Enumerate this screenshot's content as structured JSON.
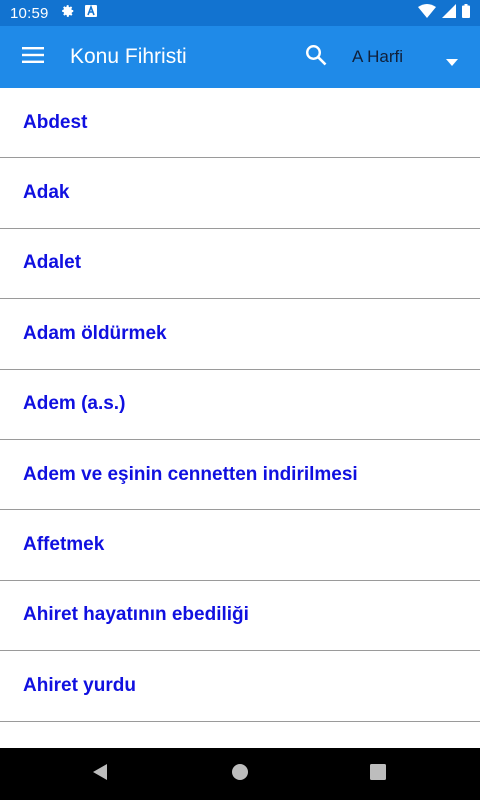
{
  "status_bar": {
    "time": "10:59",
    "icons": [
      "settings-icon",
      "keyboard-a-icon",
      "wifi-icon",
      "signal-icon",
      "battery-icon"
    ]
  },
  "app_bar": {
    "title": "Konu Fihristi",
    "menu_icon": "hamburger-menu-icon",
    "search_icon": "search-icon",
    "letter_select": {
      "value": "A Harfi",
      "icon": "dropdown-arrow-icon"
    }
  },
  "topics": [
    "Abdest",
    "Adak",
    "Adalet",
    "Adam öldürmek",
    "Adem (a.s.)",
    "Adem ve eşinin cennetten indirilmesi",
    "Affetmek",
    "Ahiret hayatının ebediliği",
    "Ahiret yurdu",
    ""
  ],
  "nav_bar": {
    "icons": [
      "back-icon",
      "home-icon",
      "recents-icon"
    ]
  },
  "colors": {
    "status_bar": "#1273d0",
    "app_bar": "#1f8ae8",
    "topic_text": "#1010e0",
    "divider": "#9a9a9a",
    "nav_bar": "#000000"
  }
}
